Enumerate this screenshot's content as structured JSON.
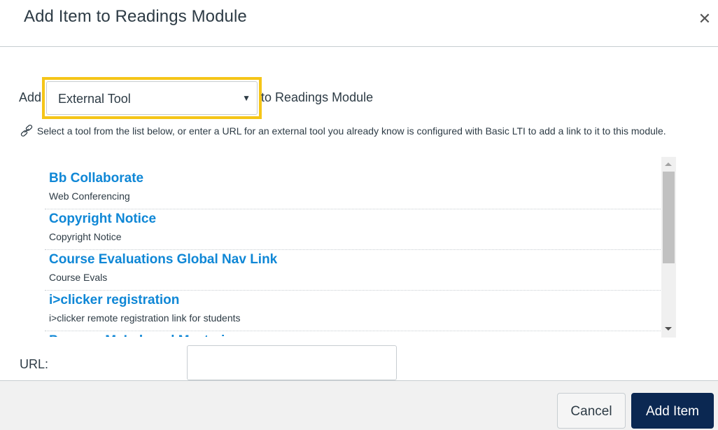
{
  "dialog": {
    "title": "Add Item to Readings Module",
    "close_icon": "close-icon"
  },
  "add_row": {
    "prefix": "Add",
    "select_value": "External Tool",
    "select_caret": "▼",
    "suffix": "to Readings Module",
    "highlight_color": "#f5c518"
  },
  "help": {
    "icon": "link-icon",
    "text": "Select a tool from the list below, or enter a URL for an external tool you already know is configured with Basic LTI to add a link to it to this module."
  },
  "tools": [
    {
      "name": "Bb Collaborate",
      "description": "Web Conferencing"
    },
    {
      "name": "Copyright Notice",
      "description": "Copyright Notice"
    },
    {
      "name": "Course Evaluations Global Nav Link",
      "description": "Course Evals"
    },
    {
      "name": "i>clicker registration",
      "description": "i>clicker remote registration link for students"
    },
    {
      "name": "Pearson MyLab and Mastering",
      "description": ""
    }
  ],
  "url": {
    "label": "URL:",
    "value": "",
    "placeholder": ""
  },
  "footer": {
    "cancel_label": "Cancel",
    "add_label": "Add Item"
  },
  "colors": {
    "link": "#0f87d6",
    "primary_button": "#0b2852",
    "text": "#2d3b45"
  }
}
